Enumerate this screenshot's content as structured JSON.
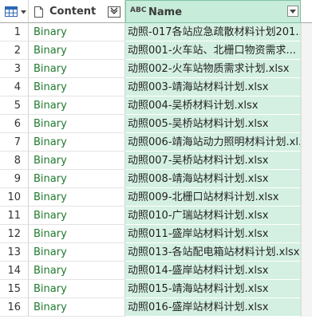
{
  "header": {
    "content_label": "Content",
    "name_label": "Name",
    "name_type_icon": "ABC",
    "expand_icon": "expand-columns-icon",
    "table_icon": "table-icon",
    "file_icon": "file-icon"
  },
  "rows": [
    {
      "index": "1",
      "content": "Binary",
      "name": "动照-017各站应急疏散材料计划201..."
    },
    {
      "index": "2",
      "content": "Binary",
      "name": "动照001-火车站、北栅口物资需求..."
    },
    {
      "index": "3",
      "content": "Binary",
      "name": "动照002-火车站物质需求计划.xlsx"
    },
    {
      "index": "4",
      "content": "Binary",
      "name": "动照003-靖海站材料计划.xlsx"
    },
    {
      "index": "5",
      "content": "Binary",
      "name": "动照004-吴桥材料计划.xlsx"
    },
    {
      "index": "6",
      "content": "Binary",
      "name": "动照005-吴桥站材料计划.xlsx"
    },
    {
      "index": "7",
      "content": "Binary",
      "name": "动照006-靖海站动力照明材料计划.xl..."
    },
    {
      "index": "8",
      "content": "Binary",
      "name": "动照007-吴桥站材料计划.xlsx"
    },
    {
      "index": "9",
      "content": "Binary",
      "name": "动照008-靖海站材料计划.xlsx"
    },
    {
      "index": "10",
      "content": "Binary",
      "name": "动照009-北栅口站材料计划.xlsx"
    },
    {
      "index": "11",
      "content": "Binary",
      "name": "动照010-广瑞站材料计划.xlsx"
    },
    {
      "index": "12",
      "content": "Binary",
      "name": "动照011-盛岸站材料计划.xlsx"
    },
    {
      "index": "13",
      "content": "Binary",
      "name": "动照013-各站配电箱站材料计划.xlsx"
    },
    {
      "index": "14",
      "content": "Binary",
      "name": "动照014-盛岸站材料计划.xlsx"
    },
    {
      "index": "15",
      "content": "Binary",
      "name": "动照015-靖海站材料计划.xlsx"
    },
    {
      "index": "16",
      "content": "Binary",
      "name": "动照016-盛岸站材料计划.xlsx"
    }
  ],
  "colors": {
    "content_text": "#1f7a2d",
    "name_column_bg": "#d4f0e2",
    "name_header_bg": "#c7ecd9"
  }
}
